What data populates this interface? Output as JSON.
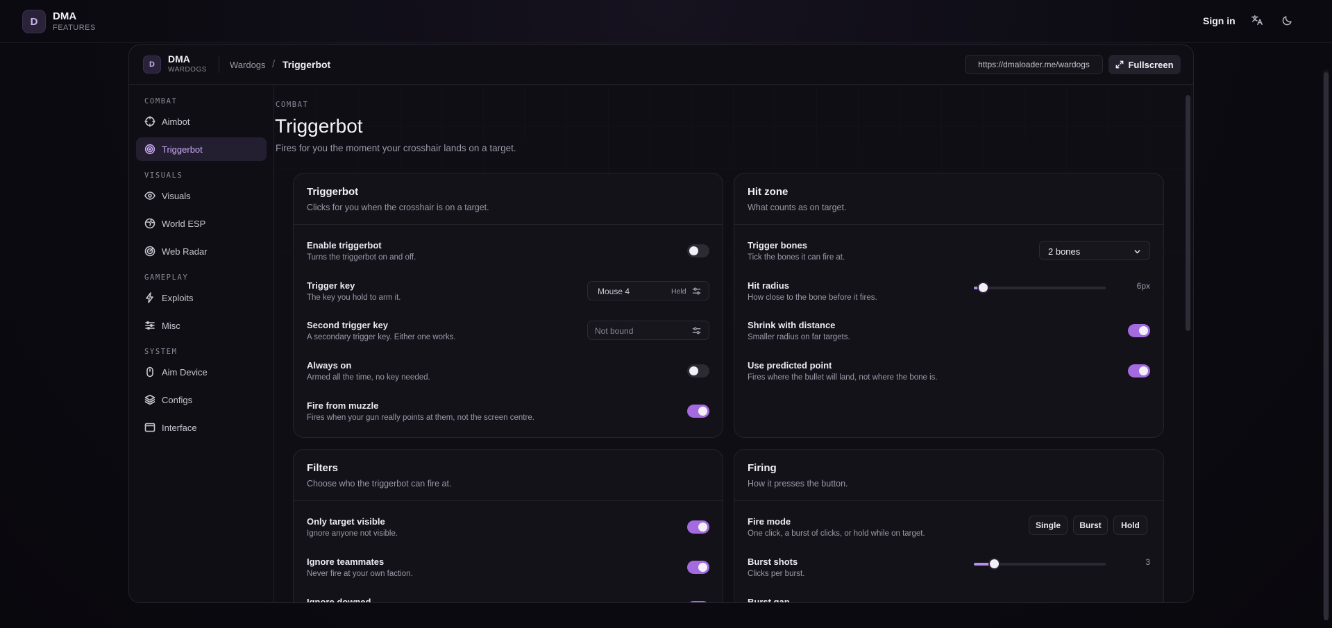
{
  "app": {
    "brand": "DMA",
    "brand_sub": "FEATURES",
    "badge": "D",
    "signin": "Sign in"
  },
  "panel": {
    "badge": "D",
    "name": "DMA",
    "sub": "WARDOGS",
    "breadcrumb": [
      "Wardogs",
      "Triggerbot"
    ],
    "url": "https://dmaloader.me/wardogs",
    "fullscreen": "Fullscreen"
  },
  "sidebar": {
    "groups": [
      "COMBAT",
      "VISUALS",
      "GAMEPLAY",
      "SYSTEM"
    ],
    "items": [
      {
        "label": "Aimbot",
        "icon": "crosshair-icon"
      },
      {
        "label": "Triggerbot",
        "icon": "target-icon"
      },
      {
        "label": "Visuals",
        "icon": "eye-icon"
      },
      {
        "label": "World ESP",
        "icon": "globe-icon"
      },
      {
        "label": "Web Radar",
        "icon": "radar-icon"
      },
      {
        "label": "Exploits",
        "icon": "bolt-icon"
      },
      {
        "label": "Misc",
        "icon": "sliders-icon"
      },
      {
        "label": "Aim Device",
        "icon": "mouse-icon"
      },
      {
        "label": "Configs",
        "icon": "layers-icon"
      },
      {
        "label": "Interface",
        "icon": "window-icon"
      }
    ]
  },
  "page": {
    "eyebrow": "COMBAT",
    "title": "Triggerbot",
    "desc": "Fires for you the moment your crosshair lands on a target."
  },
  "cards": {
    "triggerbot": {
      "title": "Triggerbot",
      "sub": "Clicks for you when the crosshair is on a target.",
      "rows": [
        {
          "label": "Enable triggerbot",
          "hint": "Turns the triggerbot on and off.",
          "on": false
        },
        {
          "label": "Trigger key",
          "hint": "The key you hold to arm it.",
          "value": "Mouse 4",
          "mode": "Held"
        },
        {
          "label": "Second trigger key",
          "hint": "A secondary trigger key. Either one works.",
          "value": "Not bound"
        },
        {
          "label": "Always on",
          "hint": "Armed all the time, no key needed.",
          "on": false
        },
        {
          "label": "Fire from muzzle",
          "hint": "Fires when your gun really points at them, not the screen centre.",
          "on": true
        }
      ]
    },
    "hitzone": {
      "title": "Hit zone",
      "sub": "What counts as on target.",
      "rows": [
        {
          "label": "Trigger bones",
          "hint": "Tick the bones it can fire at.",
          "value": "2 bones"
        },
        {
          "label": "Hit radius",
          "hint": "How close to the bone before it fires.",
          "value": "6px",
          "fraction": 0.07
        },
        {
          "label": "Shrink with distance",
          "hint": "Smaller radius on far targets.",
          "on": true
        },
        {
          "label": "Use predicted point",
          "hint": "Fires where the bullet will land, not where the bone is.",
          "on": true
        }
      ]
    },
    "filters": {
      "title": "Filters",
      "sub": "Choose who the triggerbot can fire at.",
      "rows": [
        {
          "label": "Only target visible",
          "hint": "Ignore anyone not visible.",
          "on": true
        },
        {
          "label": "Ignore teammates",
          "hint": "Never fire at your own faction.",
          "on": true
        },
        {
          "label": "Ignore downed",
          "on": true
        }
      ]
    },
    "firing": {
      "title": "Firing",
      "sub": "How it presses the button.",
      "rows": [
        {
          "label": "Fire mode",
          "hint": "One click, a burst of clicks, or hold while on target.",
          "options": [
            "Single",
            "Burst",
            "Hold"
          ]
        },
        {
          "label": "Burst shots",
          "hint": "Clicks per burst.",
          "value": "3",
          "fraction": 0.15
        },
        {
          "label": "Burst gap"
        }
      ]
    }
  },
  "colors": {
    "accent": "#a46be0",
    "active_text": "#c9a9f5",
    "background": "#0c0b12"
  }
}
